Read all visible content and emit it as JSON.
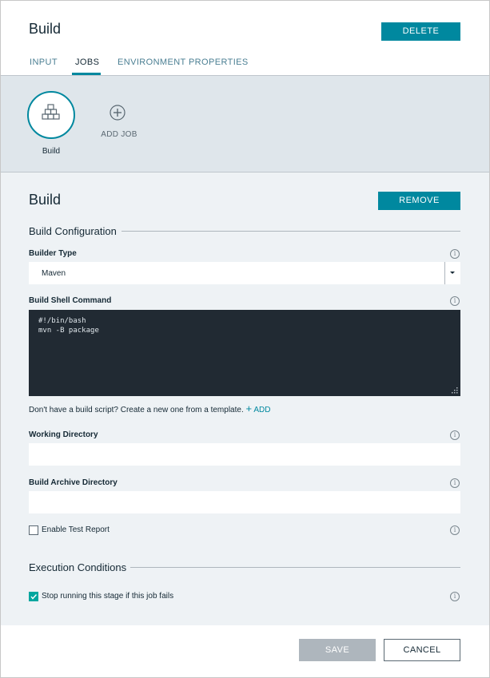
{
  "header": {
    "title": "Build",
    "delete_label": "DELETE"
  },
  "tabs": [
    {
      "label": "INPUT",
      "active": false
    },
    {
      "label": "JOBS",
      "active": true
    },
    {
      "label": "ENVIRONMENT PROPERTIES",
      "active": false
    }
  ],
  "jobs": {
    "items": [
      {
        "label": "Build",
        "icon": "build-blocks-icon"
      }
    ],
    "add_label": "ADD JOB"
  },
  "job": {
    "title": "Build",
    "remove_label": "REMOVE",
    "build_config_title": "Build Configuration",
    "builder_type_label": "Builder Type",
    "builder_type_value": "Maven",
    "shell_command_label": "Build Shell Command",
    "shell_command_lines": [
      "#!/bin/bash",
      "mvn -B package"
    ],
    "hint_text": "Don't have a build script? Create a new one from a template.",
    "hint_add_label": "ADD",
    "working_dir_label": "Working Directory",
    "working_dir_value": "",
    "archive_dir_label": "Build Archive Directory",
    "archive_dir_value": "",
    "test_report_label": "Enable Test Report",
    "test_report_checked": false,
    "exec_conditions_title": "Execution Conditions",
    "stop_running_label": "Stop running this stage if this job fails",
    "stop_running_checked": true
  },
  "footer": {
    "save_label": "SAVE",
    "cancel_label": "CANCEL"
  },
  "colors": {
    "accent": "#00889f",
    "check": "#00a69f",
    "band": "#dfe6eb",
    "panel": "#eef2f5",
    "code_bg": "#212a33"
  }
}
